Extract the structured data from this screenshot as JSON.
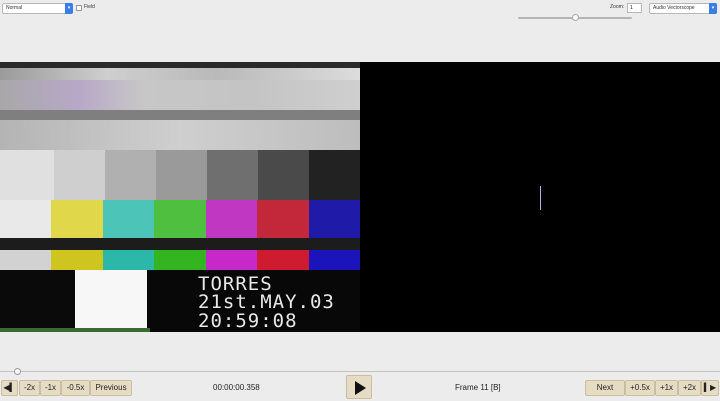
{
  "toolbar": {
    "mode_select": "Normal",
    "field_label": "Field",
    "zoom_label": "Zoom:",
    "zoom_value": "1",
    "scope_select": "Audio Vectorscope",
    "slider_level": 0.5
  },
  "video": {
    "osd_lines": [
      "TORRES",
      "21st.MAY.03",
      "20:59:08"
    ],
    "bar_colors": [
      "#e9e9e9",
      "#e0d84a",
      "#4cc4b8",
      "#4fbf3f",
      "#c038c2",
      "#c2283a",
      "#1f1aa8"
    ]
  },
  "transport": {
    "back_end_icon": "skip-to-start-icon",
    "btn_minus_2x": "-2x",
    "btn_minus_1x": "-1x",
    "btn_minus_half": "-0.5x",
    "previous": "Previous",
    "time": "00:00:00.358",
    "frame": "Frame 11 [B]",
    "next": "Next",
    "btn_plus_half": "+0.5x",
    "btn_plus_1x": "+1x",
    "btn_plus_2x": "+2x",
    "forward_end_icon": "skip-to-end-icon",
    "timeline_position": 0.02
  }
}
